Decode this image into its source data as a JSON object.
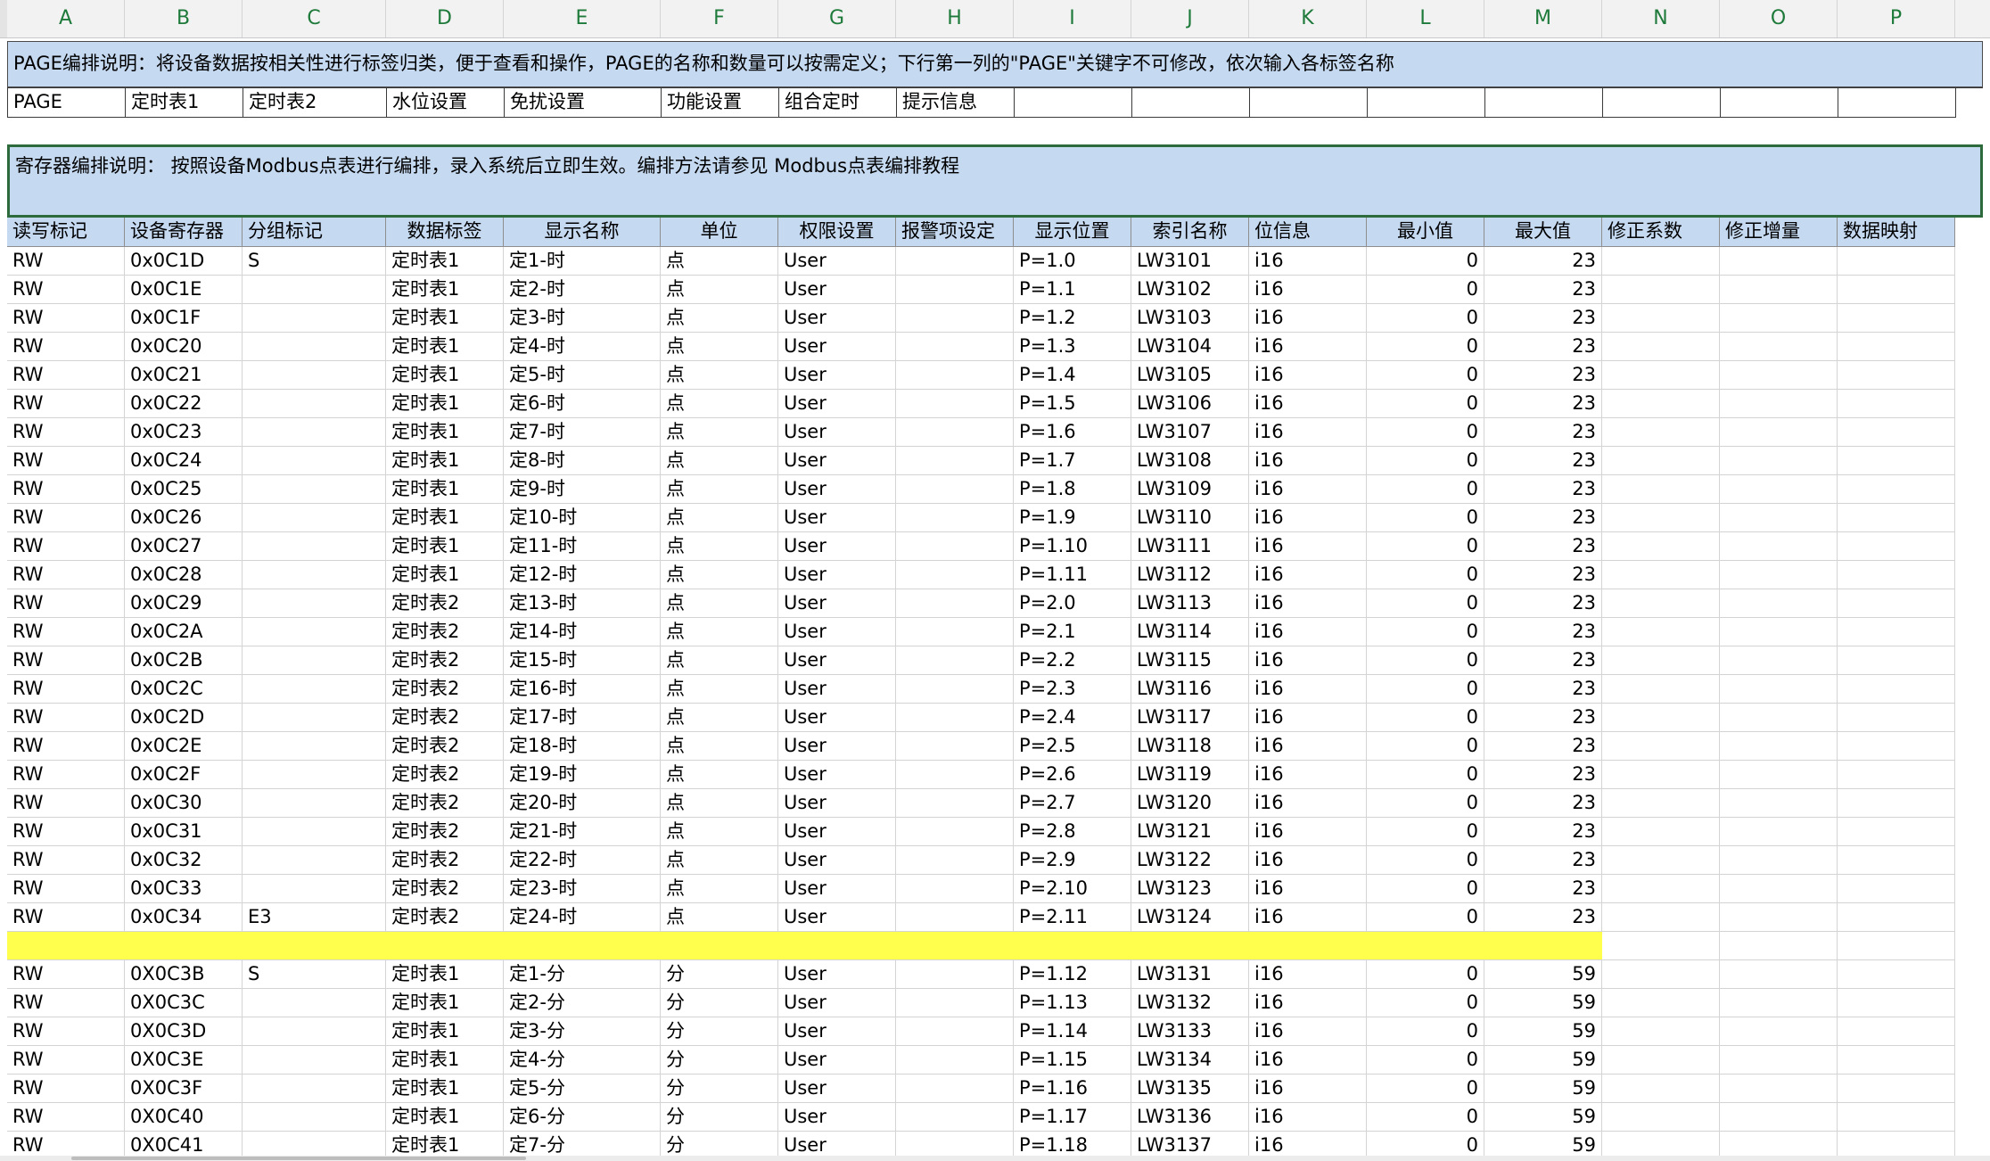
{
  "columns": [
    "A",
    "B",
    "C",
    "D",
    "E",
    "F",
    "G",
    "H",
    "I",
    "J",
    "K",
    "L",
    "M",
    "N",
    "O",
    "P"
  ],
  "page_note": "PAGE编排说明：将设备数据按相关性进行标签归类，便于查看和操作，PAGE的名称和数量可以按需定义；下行第一列的\"PAGE\"关键字不可修改，依次输入各标签名称",
  "page_row": [
    "PAGE",
    "定时表1",
    "定时表2",
    "水位设置",
    "免扰设置",
    "功能设置",
    "组合定时",
    "提示信息",
    "",
    "",
    "",
    "",
    "",
    "",
    "",
    ""
  ],
  "register_note": "寄存器编排说明： 按照设备Modbus点表进行编排，录入系统后立即生效。编排方法请参见 Modbus点表编排教程",
  "headers": [
    "读写标记",
    "设备寄存器",
    "分组标记",
    "数据标签",
    "显示名称",
    "单位",
    "权限设置",
    "报警项设定",
    "显示位置",
    "索引名称",
    "位信息",
    "最小值",
    "最大值",
    "修正系数",
    "修正增量",
    "数据映射"
  ],
  "rows_group1": [
    [
      "RW",
      "0x0C1D",
      "S",
      "定时表1",
      "定1-时",
      "点",
      "User",
      "",
      "P=1.0",
      "LW3101",
      "i16",
      "0",
      "23"
    ],
    [
      "RW",
      "0x0C1E",
      "",
      "定时表1",
      "定2-时",
      "点",
      "User",
      "",
      "P=1.1",
      "LW3102",
      "i16",
      "0",
      "23"
    ],
    [
      "RW",
      "0x0C1F",
      "",
      "定时表1",
      "定3-时",
      "点",
      "User",
      "",
      "P=1.2",
      "LW3103",
      "i16",
      "0",
      "23"
    ],
    [
      "RW",
      "0x0C20",
      "",
      "定时表1",
      "定4-时",
      "点",
      "User",
      "",
      "P=1.3",
      "LW3104",
      "i16",
      "0",
      "23"
    ],
    [
      "RW",
      "0x0C21",
      "",
      "定时表1",
      "定5-时",
      "点",
      "User",
      "",
      "P=1.4",
      "LW3105",
      "i16",
      "0",
      "23"
    ],
    [
      "RW",
      "0x0C22",
      "",
      "定时表1",
      "定6-时",
      "点",
      "User",
      "",
      "P=1.5",
      "LW3106",
      "i16",
      "0",
      "23"
    ],
    [
      "RW",
      "0x0C23",
      "",
      "定时表1",
      "定7-时",
      "点",
      "User",
      "",
      "P=1.6",
      "LW3107",
      "i16",
      "0",
      "23"
    ],
    [
      "RW",
      "0x0C24",
      "",
      "定时表1",
      "定8-时",
      "点",
      "User",
      "",
      "P=1.7",
      "LW3108",
      "i16",
      "0",
      "23"
    ],
    [
      "RW",
      "0x0C25",
      "",
      "定时表1",
      "定9-时",
      "点",
      "User",
      "",
      "P=1.8",
      "LW3109",
      "i16",
      "0",
      "23"
    ],
    [
      "RW",
      "0x0C26",
      "",
      "定时表1",
      "定10-时",
      "点",
      "User",
      "",
      "P=1.9",
      "LW3110",
      "i16",
      "0",
      "23"
    ],
    [
      "RW",
      "0x0C27",
      "",
      "定时表1",
      "定11-时",
      "点",
      "User",
      "",
      "P=1.10",
      "LW3111",
      "i16",
      "0",
      "23"
    ],
    [
      "RW",
      "0x0C28",
      "",
      "定时表1",
      "定12-时",
      "点",
      "User",
      "",
      "P=1.11",
      "LW3112",
      "i16",
      "0",
      "23"
    ],
    [
      "RW",
      "0x0C29",
      "",
      "定时表2",
      "定13-时",
      "点",
      "User",
      "",
      "P=2.0",
      "LW3113",
      "i16",
      "0",
      "23"
    ],
    [
      "RW",
      "0x0C2A",
      "",
      "定时表2",
      "定14-时",
      "点",
      "User",
      "",
      "P=2.1",
      "LW3114",
      "i16",
      "0",
      "23"
    ],
    [
      "RW",
      "0x0C2B",
      "",
      "定时表2",
      "定15-时",
      "点",
      "User",
      "",
      "P=2.2",
      "LW3115",
      "i16",
      "0",
      "23"
    ],
    [
      "RW",
      "0x0C2C",
      "",
      "定时表2",
      "定16-时",
      "点",
      "User",
      "",
      "P=2.3",
      "LW3116",
      "i16",
      "0",
      "23"
    ],
    [
      "RW",
      "0x0C2D",
      "",
      "定时表2",
      "定17-时",
      "点",
      "User",
      "",
      "P=2.4",
      "LW3117",
      "i16",
      "0",
      "23"
    ],
    [
      "RW",
      "0x0C2E",
      "",
      "定时表2",
      "定18-时",
      "点",
      "User",
      "",
      "P=2.5",
      "LW3118",
      "i16",
      "0",
      "23"
    ],
    [
      "RW",
      "0x0C2F",
      "",
      "定时表2",
      "定19-时",
      "点",
      "User",
      "",
      "P=2.6",
      "LW3119",
      "i16",
      "0",
      "23"
    ],
    [
      "RW",
      "0x0C30",
      "",
      "定时表2",
      "定20-时",
      "点",
      "User",
      "",
      "P=2.7",
      "LW3120",
      "i16",
      "0",
      "23"
    ],
    [
      "RW",
      "0x0C31",
      "",
      "定时表2",
      "定21-时",
      "点",
      "User",
      "",
      "P=2.8",
      "LW3121",
      "i16",
      "0",
      "23"
    ],
    [
      "RW",
      "0x0C32",
      "",
      "定时表2",
      "定22-时",
      "点",
      "User",
      "",
      "P=2.9",
      "LW3122",
      "i16",
      "0",
      "23"
    ],
    [
      "RW",
      "0x0C33",
      "",
      "定时表2",
      "定23-时",
      "点",
      "User",
      "",
      "P=2.10",
      "LW3123",
      "i16",
      "0",
      "23"
    ],
    [
      "RW",
      "0x0C34",
      "E3",
      "定时表2",
      "定24-时",
      "点",
      "User",
      "",
      "P=2.11",
      "LW3124",
      "i16",
      "0",
      "23"
    ]
  ],
  "rows_group2": [
    [
      "RW",
      "0X0C3B",
      "S",
      "定时表1",
      "定1-分",
      "分",
      "User",
      "",
      "P=1.12",
      "LW3131",
      "i16",
      "0",
      "59"
    ],
    [
      "RW",
      "0X0C3C",
      "",
      "定时表1",
      "定2-分",
      "分",
      "User",
      "",
      "P=1.13",
      "LW3132",
      "i16",
      "0",
      "59"
    ],
    [
      "RW",
      "0X0C3D",
      "",
      "定时表1",
      "定3-分",
      "分",
      "User",
      "",
      "P=1.14",
      "LW3133",
      "i16",
      "0",
      "59"
    ],
    [
      "RW",
      "0X0C3E",
      "",
      "定时表1",
      "定4-分",
      "分",
      "User",
      "",
      "P=1.15",
      "LW3134",
      "i16",
      "0",
      "59"
    ],
    [
      "RW",
      "0X0C3F",
      "",
      "定时表1",
      "定5-分",
      "分",
      "User",
      "",
      "P=1.16",
      "LW3135",
      "i16",
      "0",
      "59"
    ],
    [
      "RW",
      "0X0C40",
      "",
      "定时表1",
      "定6-分",
      "分",
      "User",
      "",
      "P=1.17",
      "LW3136",
      "i16",
      "0",
      "59"
    ],
    [
      "RW",
      "0X0C41",
      "",
      "定时表1",
      "定7-分",
      "分",
      "User",
      "",
      "P=1.18",
      "LW3137",
      "i16",
      "0",
      "59"
    ]
  ],
  "colors": {
    "note_fill": "#c5d9f1",
    "separator_fill": "#ffff4d",
    "column_header_text": "#1e7a3a"
  }
}
